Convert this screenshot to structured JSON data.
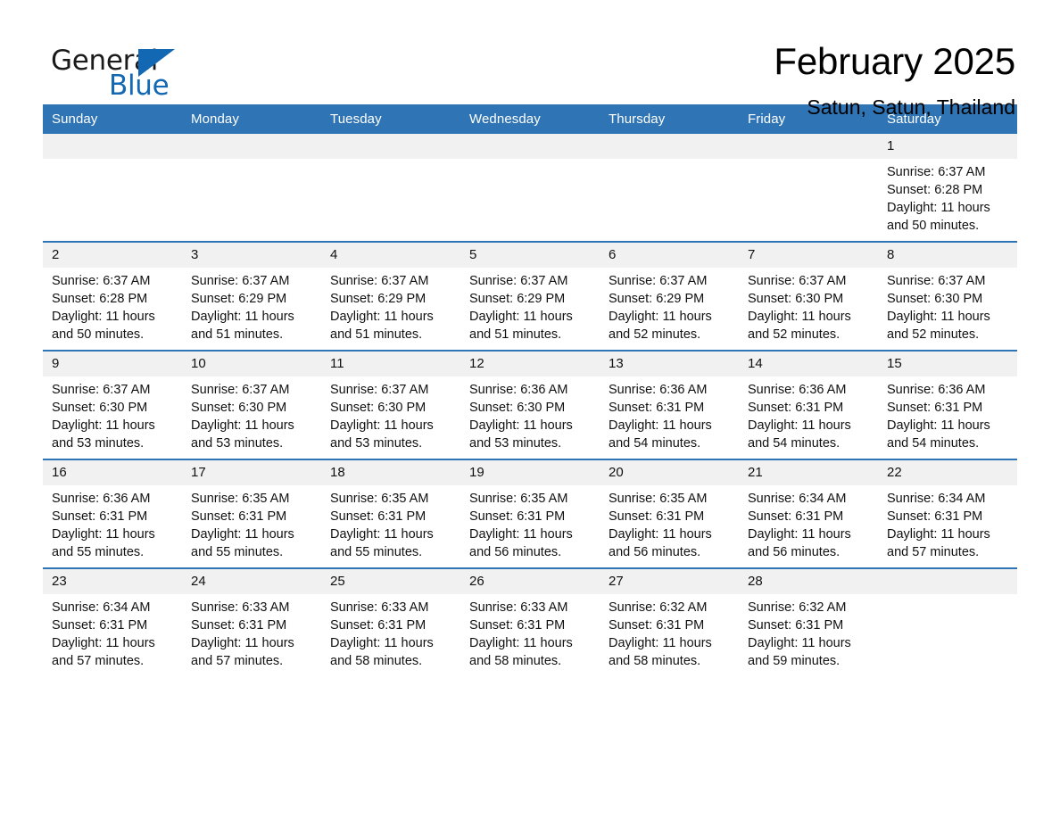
{
  "brand": {
    "name_part1": "General",
    "name_part2": "Blue",
    "triangle_color": "#1268b3"
  },
  "header": {
    "title": "February 2025",
    "subtitle": "Satun, Satun, Thailand"
  },
  "theme": {
    "header_blue": "#2f74b5",
    "daynum_band": "#f1f1f1",
    "text": "#111111"
  },
  "calendar": {
    "weekdays": [
      "Sunday",
      "Monday",
      "Tuesday",
      "Wednesday",
      "Thursday",
      "Friday",
      "Saturday"
    ],
    "weeks": [
      [
        {
          "day": "",
          "blank": true
        },
        {
          "day": "",
          "blank": true
        },
        {
          "day": "",
          "blank": true
        },
        {
          "day": "",
          "blank": true
        },
        {
          "day": "",
          "blank": true
        },
        {
          "day": "",
          "blank": true
        },
        {
          "day": "1",
          "sunrise": "Sunrise: 6:37 AM",
          "sunset": "Sunset: 6:28 PM",
          "daylight1": "Daylight: 11 hours",
          "daylight2": "and 50 minutes."
        }
      ],
      [
        {
          "day": "2",
          "sunrise": "Sunrise: 6:37 AM",
          "sunset": "Sunset: 6:28 PM",
          "daylight1": "Daylight: 11 hours",
          "daylight2": "and 50 minutes."
        },
        {
          "day": "3",
          "sunrise": "Sunrise: 6:37 AM",
          "sunset": "Sunset: 6:29 PM",
          "daylight1": "Daylight: 11 hours",
          "daylight2": "and 51 minutes."
        },
        {
          "day": "4",
          "sunrise": "Sunrise: 6:37 AM",
          "sunset": "Sunset: 6:29 PM",
          "daylight1": "Daylight: 11 hours",
          "daylight2": "and 51 minutes."
        },
        {
          "day": "5",
          "sunrise": "Sunrise: 6:37 AM",
          "sunset": "Sunset: 6:29 PM",
          "daylight1": "Daylight: 11 hours",
          "daylight2": "and 51 minutes."
        },
        {
          "day": "6",
          "sunrise": "Sunrise: 6:37 AM",
          "sunset": "Sunset: 6:29 PM",
          "daylight1": "Daylight: 11 hours",
          "daylight2": "and 52 minutes."
        },
        {
          "day": "7",
          "sunrise": "Sunrise: 6:37 AM",
          "sunset": "Sunset: 6:30 PM",
          "daylight1": "Daylight: 11 hours",
          "daylight2": "and 52 minutes."
        },
        {
          "day": "8",
          "sunrise": "Sunrise: 6:37 AM",
          "sunset": "Sunset: 6:30 PM",
          "daylight1": "Daylight: 11 hours",
          "daylight2": "and 52 minutes."
        }
      ],
      [
        {
          "day": "9",
          "sunrise": "Sunrise: 6:37 AM",
          "sunset": "Sunset: 6:30 PM",
          "daylight1": "Daylight: 11 hours",
          "daylight2": "and 53 minutes."
        },
        {
          "day": "10",
          "sunrise": "Sunrise: 6:37 AM",
          "sunset": "Sunset: 6:30 PM",
          "daylight1": "Daylight: 11 hours",
          "daylight2": "and 53 minutes."
        },
        {
          "day": "11",
          "sunrise": "Sunrise: 6:37 AM",
          "sunset": "Sunset: 6:30 PM",
          "daylight1": "Daylight: 11 hours",
          "daylight2": "and 53 minutes."
        },
        {
          "day": "12",
          "sunrise": "Sunrise: 6:36 AM",
          "sunset": "Sunset: 6:30 PM",
          "daylight1": "Daylight: 11 hours",
          "daylight2": "and 53 minutes."
        },
        {
          "day": "13",
          "sunrise": "Sunrise: 6:36 AM",
          "sunset": "Sunset: 6:31 PM",
          "daylight1": "Daylight: 11 hours",
          "daylight2": "and 54 minutes."
        },
        {
          "day": "14",
          "sunrise": "Sunrise: 6:36 AM",
          "sunset": "Sunset: 6:31 PM",
          "daylight1": "Daylight: 11 hours",
          "daylight2": "and 54 minutes."
        },
        {
          "day": "15",
          "sunrise": "Sunrise: 6:36 AM",
          "sunset": "Sunset: 6:31 PM",
          "daylight1": "Daylight: 11 hours",
          "daylight2": "and 54 minutes."
        }
      ],
      [
        {
          "day": "16",
          "sunrise": "Sunrise: 6:36 AM",
          "sunset": "Sunset: 6:31 PM",
          "daylight1": "Daylight: 11 hours",
          "daylight2": "and 55 minutes."
        },
        {
          "day": "17",
          "sunrise": "Sunrise: 6:35 AM",
          "sunset": "Sunset: 6:31 PM",
          "daylight1": "Daylight: 11 hours",
          "daylight2": "and 55 minutes."
        },
        {
          "day": "18",
          "sunrise": "Sunrise: 6:35 AM",
          "sunset": "Sunset: 6:31 PM",
          "daylight1": "Daylight: 11 hours",
          "daylight2": "and 55 minutes."
        },
        {
          "day": "19",
          "sunrise": "Sunrise: 6:35 AM",
          "sunset": "Sunset: 6:31 PM",
          "daylight1": "Daylight: 11 hours",
          "daylight2": "and 56 minutes."
        },
        {
          "day": "20",
          "sunrise": "Sunrise: 6:35 AM",
          "sunset": "Sunset: 6:31 PM",
          "daylight1": "Daylight: 11 hours",
          "daylight2": "and 56 minutes."
        },
        {
          "day": "21",
          "sunrise": "Sunrise: 6:34 AM",
          "sunset": "Sunset: 6:31 PM",
          "daylight1": "Daylight: 11 hours",
          "daylight2": "and 56 minutes."
        },
        {
          "day": "22",
          "sunrise": "Sunrise: 6:34 AM",
          "sunset": "Sunset: 6:31 PM",
          "daylight1": "Daylight: 11 hours",
          "daylight2": "and 57 minutes."
        }
      ],
      [
        {
          "day": "23",
          "sunrise": "Sunrise: 6:34 AM",
          "sunset": "Sunset: 6:31 PM",
          "daylight1": "Daylight: 11 hours",
          "daylight2": "and 57 minutes."
        },
        {
          "day": "24",
          "sunrise": "Sunrise: 6:33 AM",
          "sunset": "Sunset: 6:31 PM",
          "daylight1": "Daylight: 11 hours",
          "daylight2": "and 57 minutes."
        },
        {
          "day": "25",
          "sunrise": "Sunrise: 6:33 AM",
          "sunset": "Sunset: 6:31 PM",
          "daylight1": "Daylight: 11 hours",
          "daylight2": "and 58 minutes."
        },
        {
          "day": "26",
          "sunrise": "Sunrise: 6:33 AM",
          "sunset": "Sunset: 6:31 PM",
          "daylight1": "Daylight: 11 hours",
          "daylight2": "and 58 minutes."
        },
        {
          "day": "27",
          "sunrise": "Sunrise: 6:32 AM",
          "sunset": "Sunset: 6:31 PM",
          "daylight1": "Daylight: 11 hours",
          "daylight2": "and 58 minutes."
        },
        {
          "day": "28",
          "sunrise": "Sunrise: 6:32 AM",
          "sunset": "Sunset: 6:31 PM",
          "daylight1": "Daylight: 11 hours",
          "daylight2": "and 59 minutes."
        },
        {
          "day": "",
          "blank": true
        }
      ]
    ]
  }
}
